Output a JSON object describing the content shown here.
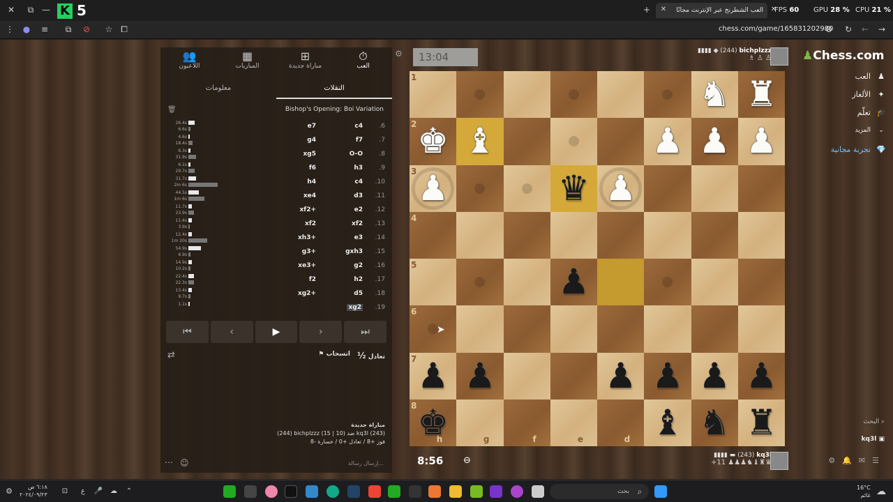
{
  "browser": {
    "tab_title": "العب الشطرنج عبر الإنترنت مجانًا",
    "tab2_title": "ال",
    "url": "chess.com/game/165831202980",
    "fps_label": "FPS",
    "fps_value": "60",
    "gpu_label": "GPU",
    "gpu_value": "28 %",
    "cpu_label": "CPU",
    "cpu_value": "21 %",
    "logo_k": "K",
    "logo_five": "5"
  },
  "panel": {
    "tabs": [
      {
        "label": "العب",
        "icon": "⏱"
      },
      {
        "label": "مباراة جديدة",
        "icon": "⊞"
      },
      {
        "label": "المباريات",
        "icon": "▦"
      },
      {
        "label": "اللاعبون",
        "icon": "👥"
      }
    ],
    "subtabs": [
      "النقلات",
      "معلومات"
    ],
    "opening": "Bishop's Opening: Boi Variation",
    "moves": [
      {
        "num": ".6",
        "w": "c4",
        "b": "e7",
        "t1": "26.4s",
        "t2": "6.6s",
        "b1": 6,
        "b2": 2
      },
      {
        "num": ".7",
        "w": "f7",
        "b": "g4",
        "t1": "4.6s",
        "t2": "18.4s",
        "b1": 1,
        "b2": 4
      },
      {
        "num": ".8",
        "w": "O-O",
        "b": "xg5",
        "t1": "6.3s",
        "t2": "31.9s",
        "b1": 2,
        "b2": 7
      },
      {
        "num": ".9",
        "w": "h3",
        "b": "f6",
        "t1": "6.1s",
        "t2": "29.7s",
        "b1": 2,
        "b2": 6
      },
      {
        "num": ".10",
        "w": "c4",
        "b": "h4",
        "t1": "31.7s",
        "t2": "2m 6s",
        "b1": 7,
        "b2": 28
      },
      {
        "num": ".11",
        "w": "d3",
        "b": "xe4",
        "t1": "44.5s",
        "t2": "1m 6s",
        "b1": 10,
        "b2": 15
      },
      {
        "num": ".12",
        "w": "e2",
        "b": "xf2+",
        "t1": "11.7s",
        "t2": "23.9s",
        "b1": 3,
        "b2": 5
      },
      {
        "num": ".13",
        "w": "xf2",
        "b": "xf2",
        "t1": "11.4s",
        "t2": "3.9s",
        "b1": 3,
        "b2": 1
      },
      {
        "num": ".14",
        "w": "e3",
        "b": "xh3+",
        "t1": "12.4s",
        "t2": "1m 20s",
        "b1": 3,
        "b2": 18
      },
      {
        "num": ".15",
        "w": "gxh3",
        "b": "g3+",
        "t1": "54.9s",
        "t2": "6.9s",
        "b1": 12,
        "b2": 2
      },
      {
        "num": ".16",
        "w": "g2",
        "b": "xe3+",
        "t1": "14.9s",
        "t2": "10.2s",
        "b1": 3,
        "b2": 2
      },
      {
        "num": ".17",
        "w": "h2",
        "b": "f2",
        "t1": "22.4s",
        "t2": "22.3s",
        "b1": 5,
        "b2": 5
      },
      {
        "num": ".18",
        "w": "d5",
        "b": "xg2+",
        "t1": "13.4s",
        "t2": "9.7s",
        "b1": 3,
        "b2": 2
      },
      {
        "num": ".19",
        "w": "xg2",
        "b": "",
        "t1": "1.1s",
        "t2": "",
        "b1": 1,
        "b2": 0
      }
    ],
    "controls": [
      "⏮",
      "‹",
      "▶",
      "›",
      "⏭"
    ],
    "draw_label": "تعادل",
    "draw_icon": "½",
    "resign_label": "انسحاب",
    "new_game_title": "مباراة جديدة",
    "new_game_line": "(244) bichplzzz ضد (10 | 15) kq3l (243)",
    "new_game_result": "فوز +8 / تعادل +0 / خسارة -8",
    "chat_placeholder": "إرسال رسالة..."
  },
  "game": {
    "top_clock": "13:04",
    "bottom_clock": "8:56",
    "top_player": "bichplzzz",
    "top_rating": "(244)",
    "bottom_player": "kq3l",
    "bottom_rating": "(243)",
    "bottom_material": "+11"
  },
  "board": {
    "ranks": [
      "1",
      "2",
      "3",
      "4",
      "5",
      "6",
      "7",
      "8"
    ],
    "files": [
      "h",
      "g",
      "f",
      "e",
      "d"
    ],
    "pieces": [
      {
        "r": 0,
        "c": 6,
        "p": "♞",
        "col": "w"
      },
      {
        "r": 0,
        "c": 7,
        "p": "♜",
        "col": "w"
      },
      {
        "r": 1,
        "c": 0,
        "p": "♚",
        "col": "w"
      },
      {
        "r": 1,
        "c": 1,
        "p": "♝",
        "col": "w"
      },
      {
        "r": 1,
        "c": 5,
        "p": "♟",
        "col": "w"
      },
      {
        "r": 1,
        "c": 6,
        "p": "♟",
        "col": "w"
      },
      {
        "r": 1,
        "c": 7,
        "p": "♟",
        "col": "w"
      },
      {
        "r": 2,
        "c": 0,
        "p": "♟",
        "col": "w"
      },
      {
        "r": 2,
        "c": 3,
        "p": "♛",
        "col": "b"
      },
      {
        "r": 2,
        "c": 4,
        "p": "♟",
        "col": "w"
      },
      {
        "r": 4,
        "c": 3,
        "p": "♟",
        "col": "b"
      },
      {
        "r": 6,
        "c": 0,
        "p": "♟",
        "col": "b"
      },
      {
        "r": 6,
        "c": 1,
        "p": "♟",
        "col": "b"
      },
      {
        "r": 6,
        "c": 4,
        "p": "♟",
        "col": "b"
      },
      {
        "r": 6,
        "c": 5,
        "p": "♟",
        "col": "b"
      },
      {
        "r": 6,
        "c": 6,
        "p": "♟",
        "col": "b"
      },
      {
        "r": 6,
        "c": 7,
        "p": "♟",
        "col": "b"
      },
      {
        "r": 7,
        "c": 0,
        "p": "♚",
        "col": "b"
      },
      {
        "r": 7,
        "c": 5,
        "p": "♝",
        "col": "b"
      },
      {
        "r": 7,
        "c": 6,
        "p": "♞",
        "col": "b"
      },
      {
        "r": 7,
        "c": 7,
        "p": "♜",
        "col": "b"
      }
    ],
    "highlights": [
      {
        "r": 1,
        "c": 1
      },
      {
        "r": 2,
        "c": 3
      },
      {
        "r": 4,
        "c": 4
      }
    ],
    "hints": [
      {
        "r": 0,
        "c": 1
      },
      {
        "r": 0,
        "c": 3
      },
      {
        "r": 0,
        "c": 5
      },
      {
        "r": 1,
        "c": 3
      },
      {
        "r": 2,
        "c": 1
      },
      {
        "r": 2,
        "c": 2
      },
      {
        "r": 4,
        "c": 1
      },
      {
        "r": 4,
        "c": 5
      },
      {
        "r": 5,
        "c": 0
      }
    ],
    "rings": [
      {
        "r": 2,
        "c": 0
      },
      {
        "r": 2,
        "c": 4
      }
    ]
  },
  "site": {
    "logo": "Chess.com",
    "nav": [
      {
        "label": "العب",
        "icon": "♟"
      },
      {
        "label": "الألغاز",
        "icon": "✦"
      },
      {
        "label": "تعلّم",
        "icon": "🎓"
      },
      {
        "label": "المزيد",
        "icon": "⌄"
      },
      {
        "label": "تجربة مجانية",
        "icon": "💎"
      }
    ],
    "search_label": "البحث",
    "user": "kq3l"
  },
  "taskbar": {
    "time": "٦:١٨ ص",
    "date": "٢٠٢٤/٠٩/٢٣",
    "search": "بحث",
    "temp": "16°C",
    "weather": "غائم"
  }
}
